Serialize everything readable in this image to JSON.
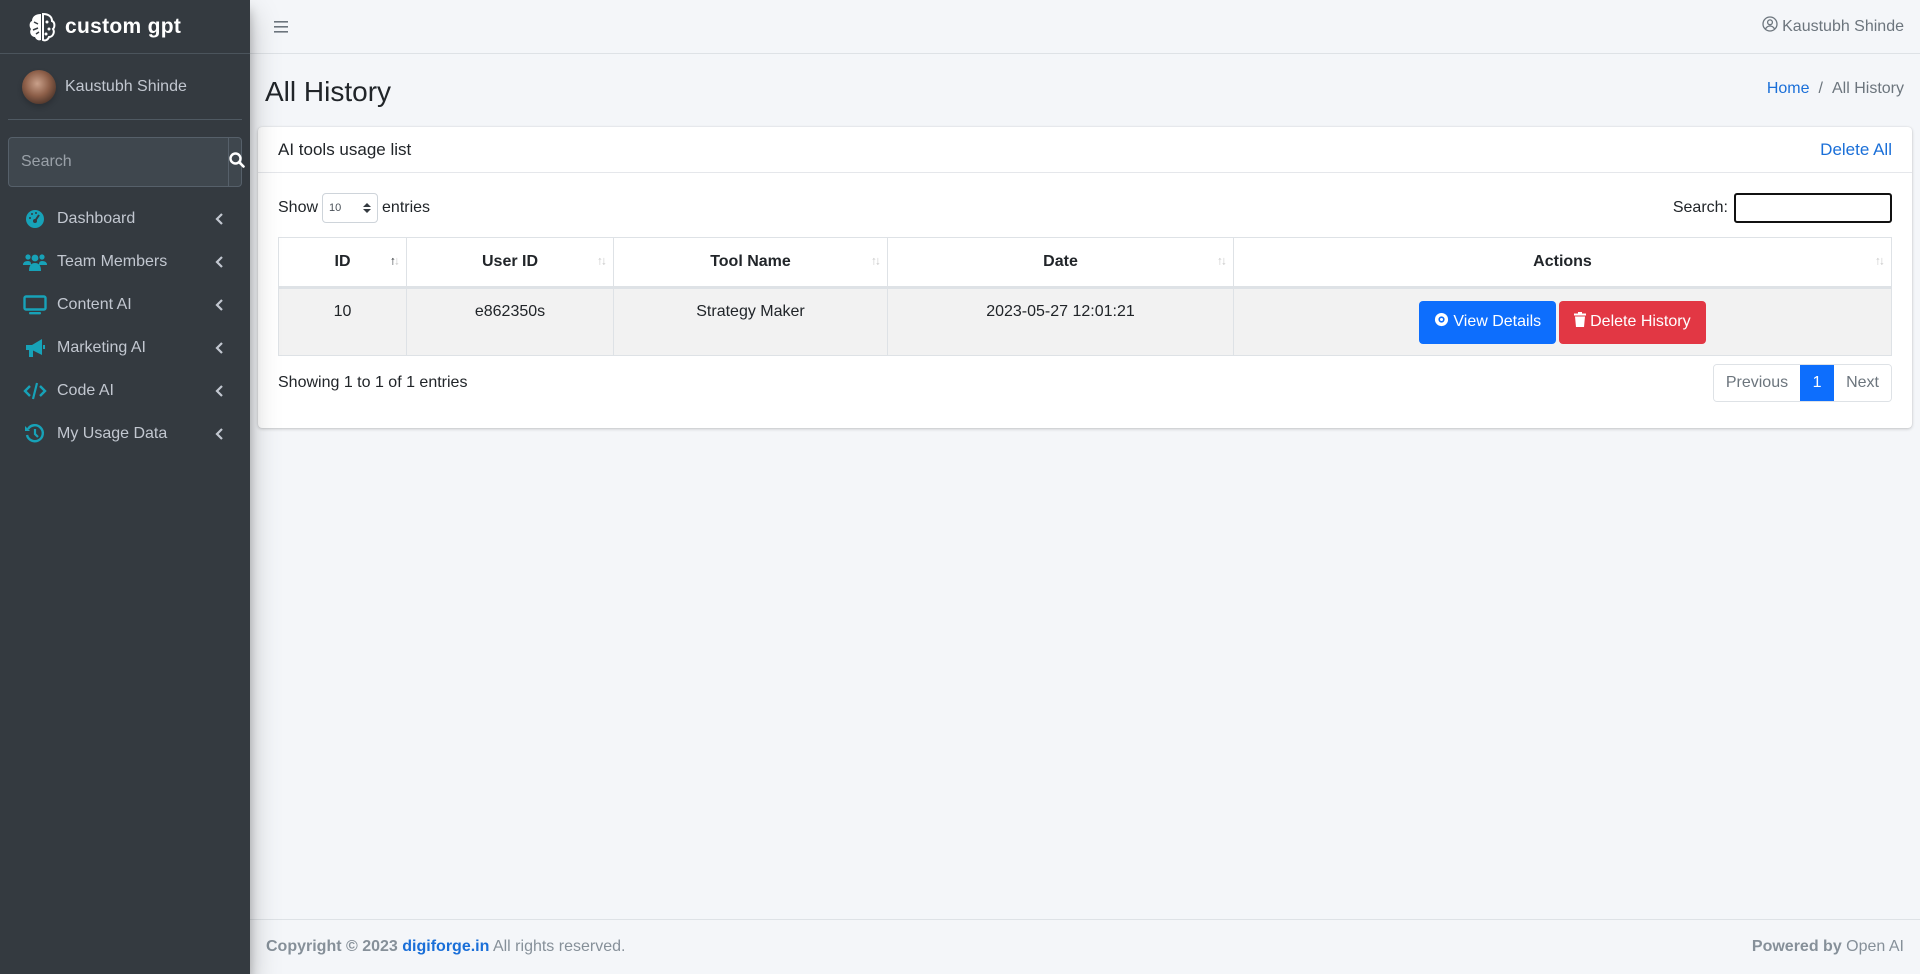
{
  "brand": {
    "name": "custom gpt",
    "logo_icon": "brain-icon"
  },
  "sidebar": {
    "user_name": "Kaustubh Shinde",
    "search_placeholder": "Search",
    "search_value": "",
    "items": [
      {
        "label": "Dashboard",
        "icon": "gauge-icon"
      },
      {
        "label": "Team Members",
        "icon": "users-icon"
      },
      {
        "label": "Content AI",
        "icon": "desktop-icon"
      },
      {
        "label": "Marketing AI",
        "icon": "bullhorn-icon"
      },
      {
        "label": "Code AI",
        "icon": "code-icon"
      },
      {
        "label": "My Usage Data",
        "icon": "history-icon"
      }
    ]
  },
  "topbar": {
    "user_name": "Kaustubh Shinde"
  },
  "header": {
    "title": "All History",
    "breadcrumb": {
      "home": "Home",
      "separator": "/",
      "current": "All History"
    }
  },
  "card": {
    "title": "AI tools usage list",
    "delete_all": "Delete All",
    "length": {
      "show": "Show",
      "value": "10",
      "entries": "entries"
    },
    "search": {
      "label": "Search:",
      "value": ""
    },
    "table": {
      "columns": [
        "ID",
        "User ID",
        "Tool Name",
        "Date",
        "Actions"
      ],
      "sorted_column": "ID",
      "rows": [
        {
          "id": "10",
          "user_id": "e862350s",
          "tool_name": "Strategy Maker",
          "date": "2023-05-27 12:01:21"
        }
      ],
      "actions": {
        "view": "View Details",
        "delete": "Delete History"
      }
    },
    "info": "Showing 1 to 1 of 1 entries",
    "pagination": {
      "previous": "Previous",
      "current": "1",
      "next": "Next"
    }
  },
  "footer": {
    "copyright": "Copyright © 2023",
    "company": "digiforge.in",
    "rights": "All rights reserved.",
    "powered_by": "Powered by",
    "powered_name": "Open AI"
  },
  "colors": {
    "sidebar_bg": "#343a40",
    "accent_icon": "#17a2b8",
    "primary": "#0d6efd",
    "danger": "#e23744",
    "link": "#1a6fd8"
  }
}
